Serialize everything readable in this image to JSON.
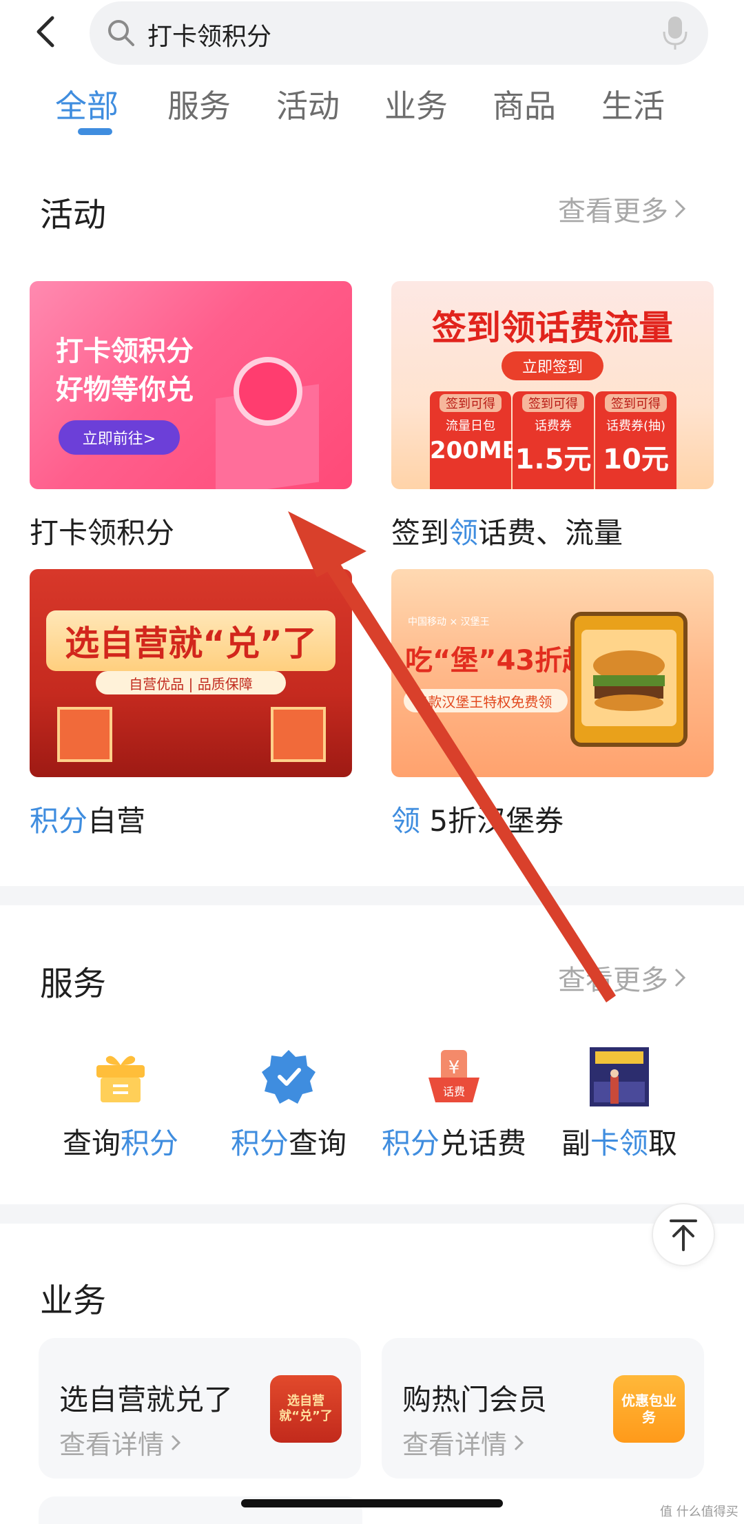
{
  "search": {
    "query": "打卡领积分"
  },
  "tabs": [
    "全部",
    "服务",
    "活动",
    "业务",
    "商品",
    "生活"
  ],
  "activity": {
    "title": "活动",
    "more": "查看更多",
    "cards": [
      {
        "line1": "打卡领积分",
        "line2": "好物等你兑",
        "button": "立即前往>",
        "caption": "打卡领积分"
      },
      {
        "headline": "签到领话费流量",
        "button": "立即签到",
        "caption_a": "签到",
        "caption_b": "领",
        "caption_c": "话费、流量",
        "boxes": [
          {
            "tag": "签到可得",
            "label": "流量日包",
            "value": "200MB"
          },
          {
            "tag": "签到可得",
            "label": "话费券",
            "value": "1.5元"
          },
          {
            "tag": "签到可得",
            "label": "话费券(抽)",
            "value": "10元"
          }
        ]
      },
      {
        "banner": "选自营就“兑”了",
        "sub": "自营优品 | 品质保障",
        "caption_a": "积分",
        "caption_b": "自营"
      },
      {
        "logos": "中国移动 × 汉堡王",
        "headline": "吃“堡”43折起!",
        "sub": "5款汉堡王特权免费领",
        "caption_a": "领",
        "caption_b": "5折汉堡券"
      }
    ]
  },
  "service": {
    "title": "服务",
    "more": "查看更多",
    "items": [
      {
        "a": "查询",
        "b": "积分",
        "icon": "gift-icon"
      },
      {
        "a": "积分",
        "b": "查询",
        "icon": "verified-badge-icon"
      },
      {
        "a": "积分",
        "b": "兑话费",
        "icon": "phone-bill-icon",
        "badge": "话费"
      },
      {
        "a": "副",
        "b": "卡领",
        "c": "取",
        "icon": "sub-card-poster-icon"
      }
    ]
  },
  "business": {
    "title": "业务",
    "items": [
      {
        "name": "选自营就兑了",
        "detail": "查看详情",
        "thumb": "选自营就“兑”了"
      },
      {
        "name": "购热门会员",
        "detail": "查看详情",
        "thumb": "优惠包业务"
      }
    ]
  },
  "watermark": "值 什么值得买",
  "colors": {
    "accent": "#3f8ddf",
    "arrow": "#d9402b"
  }
}
